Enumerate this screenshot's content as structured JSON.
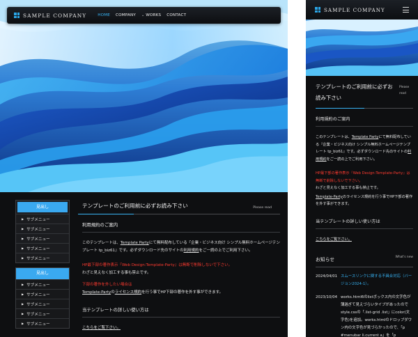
{
  "company_name": "SAMPLE COMPANY",
  "nav": [
    {
      "label": "HOME",
      "active": true
    },
    {
      "label": "COMPANY",
      "active": false
    },
    {
      "label": "WORKS",
      "active": false,
      "dropdown": true
    },
    {
      "label": "CONTACT",
      "active": false
    }
  ],
  "sidebar": {
    "box1": {
      "heading": "見出し",
      "items": [
        "サブメニュー",
        "サブメニュー",
        "サブメニュー",
        "サブメニュー",
        "サブメニュー"
      ]
    },
    "box2": {
      "heading": "見出し",
      "items": [
        "サブメニュー",
        "サブメニュー",
        "サブメニュー",
        "サブメニュー",
        "サブメニュー"
      ]
    }
  },
  "main": {
    "title": "テンプレートのご利用前に必ずお読み下さい",
    "title_en": "Please read",
    "section1_heading": "利用規約のご案内",
    "para1_pre": "このテンプレートは、",
    "para1_link1": "Template Party",
    "para1_mid": "にて無料配布している『企業・ビジネス向け シンプル無料ホームページテンプレート tp_biz61』です。必ずダウンロード先のサイトの",
    "para1_link2": "利用規約",
    "para1_post": "をご一読の上でご利用下さい。",
    "red1": "HP最下部の著作表示『Web Design:Template-Party』は無断で削除しないで下さい。",
    "para2": "わざと見えなく加工する事も禁止です。",
    "red2": "下部の著作を外したい場合は",
    "para3_link1": "Template-Party",
    "para3_mid": "の",
    "para3_link2": "ライセンス規約",
    "para3_post": "を行う事でHP下部の著作を外す事ができます。",
    "section2_heading": "当テンプレートの詳しい使い方は",
    "section2_link": "こちらをご覧下さい。"
  },
  "mobile": {
    "title": "テンプレートのご利用前に必ずお読み下さい",
    "title_en": "Please read",
    "section1_heading": "利用規約のご案内",
    "para1_pre": "このテンプレートは、",
    "para1_link1": "Template Party",
    "para1_mid": "にて無料配布している『企業・ビジネス向け シンプル無料ホームページテンプレート tp_biz61』です。必ずダウンロード先のサイトの",
    "para1_link2": "利用規約",
    "para1_post": "をご一読の上でご利用下さい。",
    "red1": "HP最下部の著作表示『Web Design:Template-Party』は無断で削除しないで下さい。",
    "para2": "わざと見えなく加工する事も禁止です。",
    "para3_link": "Template-Party",
    "para3_post": "のライセンス規約を行う事でHP下部の著作を外す事ができます。",
    "section2_heading": "当テンプレートの詳しい使い方は",
    "section2_link": "こちらをご覧下さい。",
    "news_heading": "お知らせ",
    "news_heading_en": "What's new",
    "news": [
      {
        "date": "2024/04/01",
        "text": "スムースリンクに関する不具合対応（バージョン2024-1）。",
        "link": true
      },
      {
        "date": "2023/10/04",
        "text": "works.html6のlistボックス内の文字色が薄過ぎて見えづらいタイプがあったのでstyle.cssの「.list-grid .list」にcolor(文字色)を追加。works.htmlのドロップダウン内の文字色が見づらかったので、「p #menubar li.current a」を「p",
        "link": false
      }
    ]
  },
  "colors": {
    "accent": "#38b4f6",
    "sidebar_heading": "#3aa9f0",
    "warning": "#ff3b30",
    "background": "#0e0f11"
  }
}
